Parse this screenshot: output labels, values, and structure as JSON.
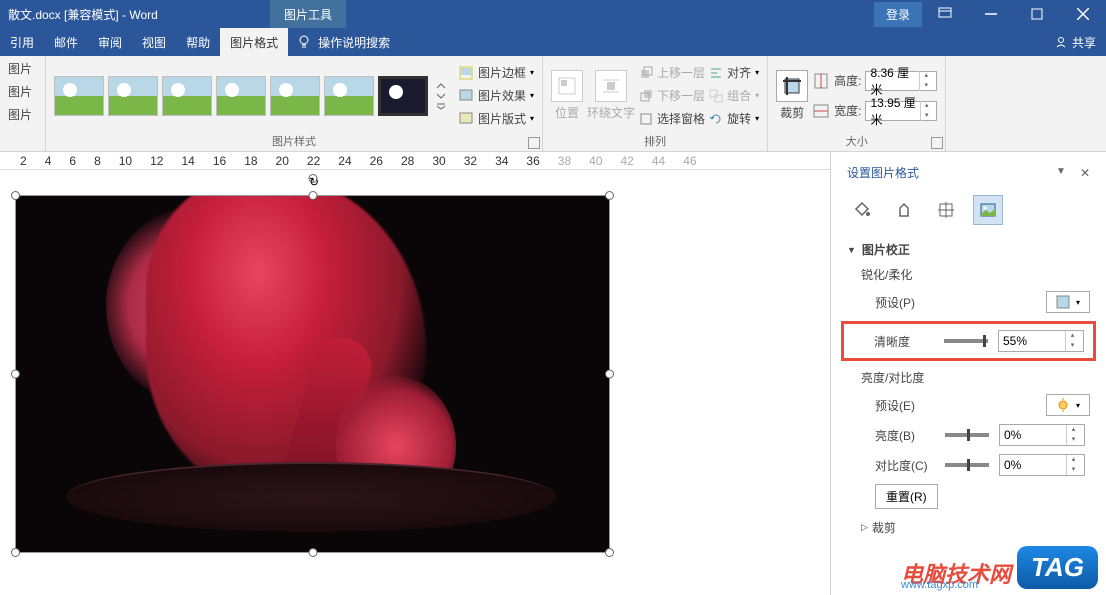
{
  "titlebar": {
    "doc_title": "散文.docx [兼容模式] - Word",
    "context_tab": "图片工具",
    "login": "登录"
  },
  "menu": {
    "items": [
      "引用",
      "邮件",
      "审阅",
      "视图",
      "帮助",
      "图片格式"
    ],
    "tell_me": "操作说明搜索",
    "share": "共享"
  },
  "ribbon": {
    "g1": {
      "items": [
        "图片",
        "图片",
        "图片"
      ]
    },
    "styles_label": "图片样式",
    "border": "图片边框",
    "effects": "图片效果",
    "layout": "图片版式",
    "position": "位置",
    "wrap": "环绕文字",
    "bring_fwd": "上移一层",
    "send_back": "下移一层",
    "selection": "选择窗格",
    "align": "对齐",
    "group": "组合",
    "rotate": "旋转",
    "arrange_label": "排列",
    "crop": "裁剪",
    "height_lbl": "高度:",
    "height_val": "8.36 厘米",
    "width_lbl": "宽度:",
    "width_val": "13.95 厘米",
    "size_label": "大小"
  },
  "ruler": [
    "2",
    "4",
    "6",
    "8",
    "10",
    "12",
    "14",
    "16",
    "18",
    "20",
    "22",
    "24",
    "26",
    "28",
    "30",
    "32",
    "34",
    "36",
    "38",
    "40",
    "42",
    "44",
    "46"
  ],
  "panel": {
    "title": "设置图片格式",
    "section_correction": "图片校正",
    "sharpen": "锐化/柔化",
    "preset_p": "预设(P)",
    "sharpness": "清晰度",
    "sharpness_val": "55%",
    "brightness_contrast": "亮度/对比度",
    "preset_e": "预设(E)",
    "brightness": "亮度(B)",
    "brightness_val": "0%",
    "contrast": "对比度(C)",
    "contrast_val": "0%",
    "reset": "重置(R)",
    "crop": "裁剪"
  },
  "watermark": {
    "text": "电脑技术网",
    "url": "www.tagxp.com",
    "tag": "TAG"
  }
}
